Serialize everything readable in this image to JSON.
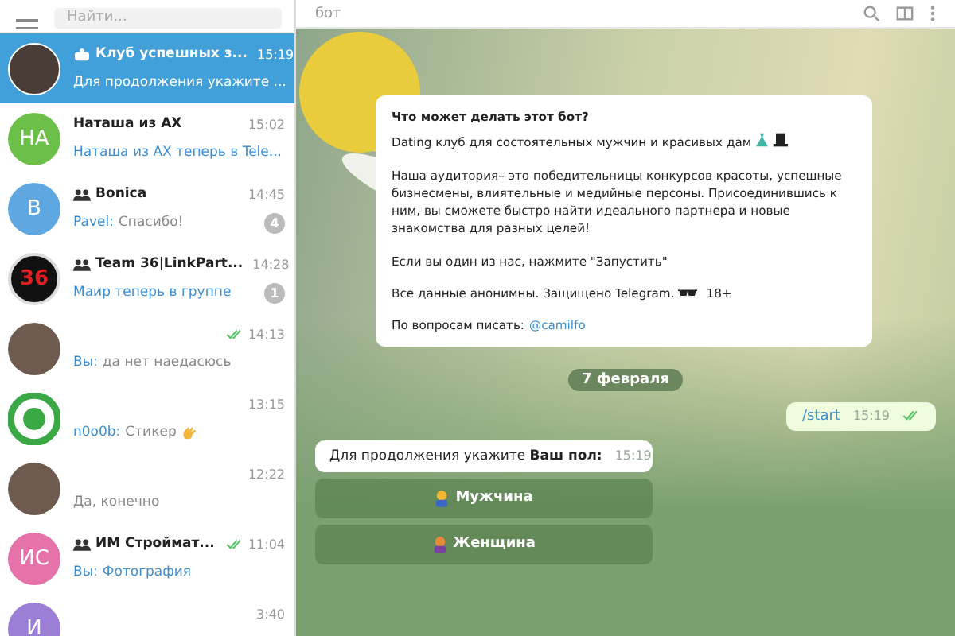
{
  "sidebar": {
    "search": {
      "placeholder": "Найти..."
    },
    "chats": [
      {
        "avatar": {
          "kind": "photo"
        },
        "bot": true,
        "group": false,
        "name": "Клуб успешных з...",
        "time": "15:19",
        "preview": "Для продолжения укажите ...",
        "highlight": false,
        "read_mark": false,
        "selected": true
      },
      {
        "avatar": {
          "kind": "initials",
          "text": "НА",
          "color": "#6cc04a"
        },
        "bot": false,
        "group": false,
        "name": "Наташа из АХ",
        "time": "15:02",
        "preview": "Наташа из АХ теперь в Tele...",
        "highlight": true,
        "read_mark": false,
        "selected": false
      },
      {
        "avatar": {
          "kind": "initials",
          "text": "B",
          "color": "#5ea7e0"
        },
        "bot": false,
        "group": true,
        "name": "Bonica",
        "time": "14:45",
        "sender": "Pavel:",
        "preview": "Спасибо!",
        "highlight": false,
        "read_mark": false,
        "unread": "4",
        "selected": false
      },
      {
        "avatar": {
          "kind": "logo-36",
          "text": "36"
        },
        "bot": false,
        "group": true,
        "name": "Team 36|LinkPart...",
        "time": "14:28",
        "preview": "Маир теперь в группе",
        "highlight": true,
        "read_mark": false,
        "unread": "1",
        "selected": false
      },
      {
        "avatar": {
          "kind": "photo"
        },
        "bot": false,
        "group": false,
        "time": "14:13",
        "sender": "Вы:",
        "preview": "да нет наедасюсь",
        "highlight": false,
        "read_mark": true,
        "selected": false
      },
      {
        "avatar": {
          "kind": "ring-logo"
        },
        "bot": false,
        "group": false,
        "time": "13:15",
        "sender": "n0o0b:",
        "preview": "Стикер",
        "icon": {
          "kind": "wave"
        },
        "highlight": false,
        "read_mark": false,
        "selected": false
      },
      {
        "avatar": {
          "kind": "photo"
        },
        "bot": false,
        "group": false,
        "time": "12:22",
        "preview": "Да, конечно",
        "highlight": false,
        "read_mark": false,
        "selected": false
      },
      {
        "avatar": {
          "kind": "initials",
          "text": "ИС",
          "color": "#e572a8"
        },
        "bot": false,
        "group": true,
        "name": "ИМ Строймат...",
        "time": "11:04",
        "sender": "Вы:",
        "preview": "Фотография",
        "highlight": true,
        "read_mark": true,
        "selected": false
      },
      {
        "avatar": {
          "kind": "initials",
          "text": "И",
          "color": "#9b7fd6"
        },
        "bot": false,
        "group": false,
        "time": "3:40",
        "read_mark": false,
        "selected": false
      }
    ]
  },
  "chat": {
    "subtitle": "бот",
    "bot_info": {
      "title": "Что может делать этот бот?",
      "paragraphs": [
        {
          "text": "Dating клуб для состоятельных мужчин и красивых дам",
          "icon": {
            "kind": "dress-hat"
          }
        },
        {
          "text": "Наша аудитория– это победительницы конкурсов красоты, успешные бизнесмены, влиятельные и медийные персоны. Присоединившись к ним, вы сможете быстро найти идеального партнера и новые знакомства для разных целей!"
        },
        {
          "text": "Если вы один из нас, нажмите \"Запустить\""
        },
        {
          "text": "Все данные анонимны. Защищено Telegram.",
          "icon": {
            "kind": "sunglasses"
          },
          "suffix": "18+"
        },
        {
          "text": "По вопросам писать:",
          "link": "@camilfo"
        }
      ]
    },
    "date": "7 февраля",
    "messages": [
      {
        "kind": "outgoing",
        "text": "/start",
        "time": "15:19",
        "read": true
      },
      {
        "kind": "incoming",
        "text": "Для продолжения укажите **Ваш пол:**",
        "time": "15:19",
        "buttons": [
          "Мужчина",
          "Женщина"
        ]
      }
    ]
  }
}
